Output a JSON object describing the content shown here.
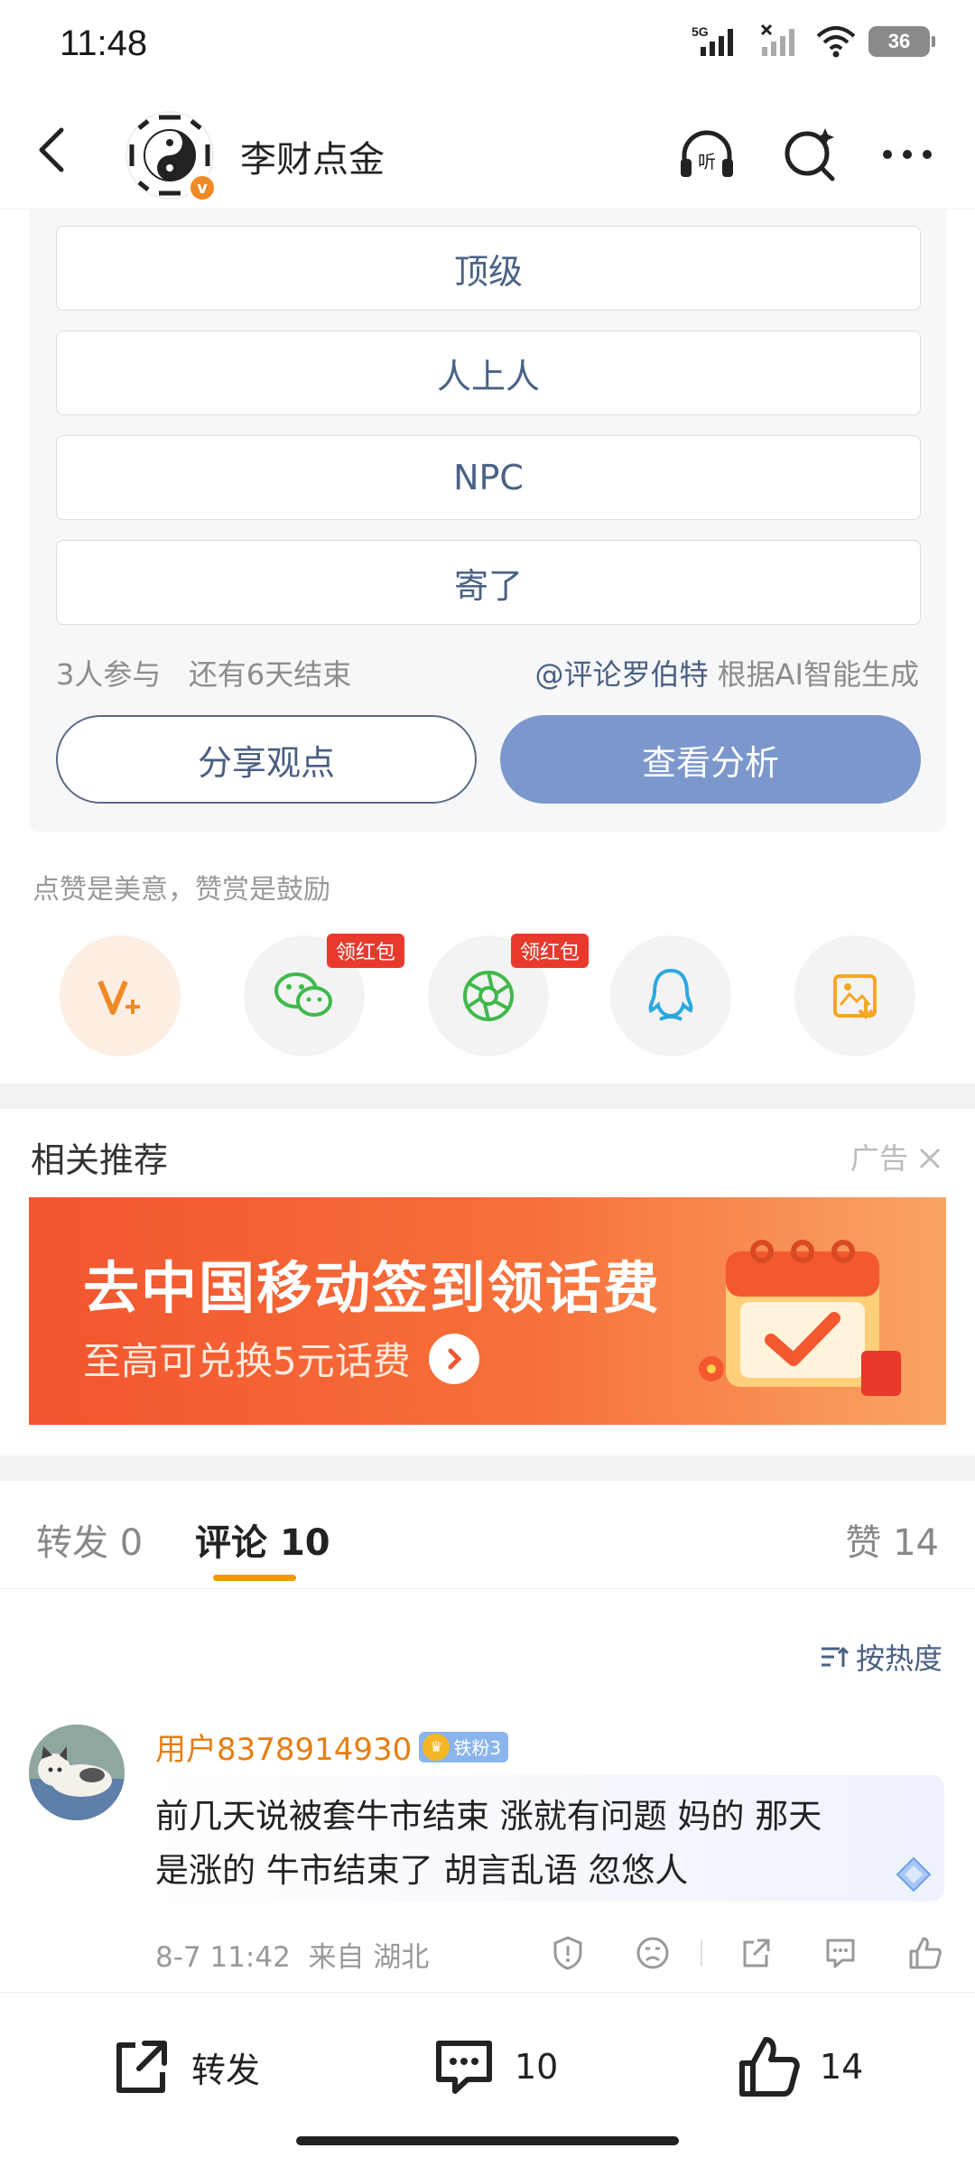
{
  "status_bar": {
    "time": "11:48",
    "network": "5G",
    "battery": "36"
  },
  "header": {
    "title": "李财点金",
    "verified_badge": "v",
    "icons": [
      "back-icon",
      "listen-icon",
      "ai-search-icon",
      "more-icon"
    ]
  },
  "poll": {
    "options": [
      "顶级",
      "人上人",
      "NPC",
      "寄了"
    ],
    "participants": "3人参与",
    "remaining": "还有6天结束",
    "credit_mention": "@评论罗伯特",
    "credit_text": "根据AI智能生成",
    "share_button": "分享观点",
    "analysis_button": "查看分析"
  },
  "reward": {
    "text": "点赞是美意，赞赏是鼓励"
  },
  "share_row": {
    "red_packet_tag": "领红包",
    "items": [
      "reward-v-icon",
      "wechat-icon",
      "moments-icon",
      "qq-icon",
      "save-image-icon"
    ]
  },
  "related": {
    "title": "相关推荐",
    "ad_label": "广告",
    "banner_title": "去中国移动签到领话费",
    "banner_subtitle": "至高可兑换5元话费"
  },
  "tabs": {
    "repost_label": "转发",
    "repost_count": "0",
    "comment_label": "评论",
    "comment_count": "10",
    "like_label": "赞",
    "like_count": "14"
  },
  "sort": {
    "label": "按热度"
  },
  "comment": {
    "user": "用户8378914930",
    "fan_badge": "铁粉3",
    "text_line1": "前几天说被套牛市结束 涨就有问题  妈的 那天",
    "text_line2": "是涨的 牛市结束了 胡言乱语 忽悠人",
    "time": "8-7 11:42",
    "location": "来自 湖北"
  },
  "bottom_bar": {
    "repost_label": "转发",
    "comment_count": "10",
    "like_count": "14"
  },
  "colors": {
    "accent_orange": "#f39800",
    "link_blue": "#4a5f82",
    "analysis_button": "#7b97cc",
    "banner_red": "#f2552f"
  }
}
